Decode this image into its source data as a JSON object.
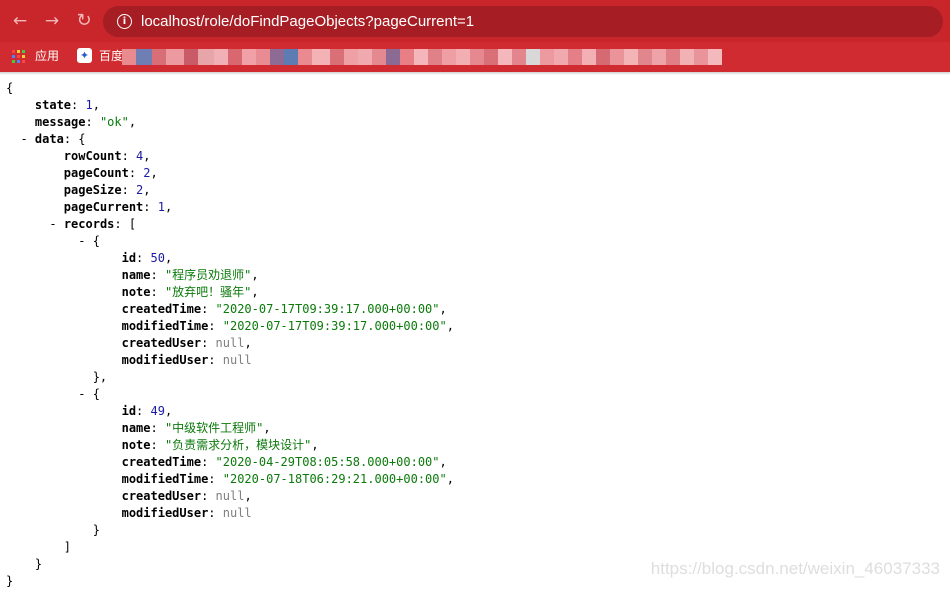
{
  "browser": {
    "url": "localhost/role/doFindPageObjects?pageCurrent=1",
    "bookmarks": [
      {
        "label": "应用",
        "icon": "apps-grid-icon"
      },
      {
        "label": "百度",
        "icon": "baidu-paw-icon"
      }
    ],
    "colors": {
      "toolbar": "#c8262b",
      "omnibox": "#a61e24",
      "bookmarks": "#cf2b31"
    }
  },
  "json": {
    "brace_open": "{",
    "brace_close": "}",
    "state_key": "state",
    "state_val": "1",
    "message_key": "message",
    "message_val": "\"ok\"",
    "data_key": "data",
    "rowCount_key": "rowCount",
    "rowCount_val": "4",
    "pageCount_key": "pageCount",
    "pageCount_val": "2",
    "pageSize_key": "pageSize",
    "pageSize_val": "2",
    "pageCurrent_key": "pageCurrent",
    "pageCurrent_val": "1",
    "records_key": "records",
    "records": [
      {
        "id": "50",
        "name": "\"程序员劝退师\"",
        "note": "\"放弃吧！骚年\"",
        "createdTime": "\"2020-07-17T09:39:17.000+00:00\"",
        "modifiedTime": "\"2020-07-17T09:39:17.000+00:00\"",
        "createdUser": "null",
        "modifiedUser": "null"
      },
      {
        "id": "49",
        "name": "\"中级软件工程师\"",
        "note": "\"负责需求分析，模块设计\"",
        "createdTime": "\"2020-04-29T08:05:58.000+00:00\"",
        "modifiedTime": "\"2020-07-18T06:29:21.000+00:00\"",
        "createdUser": "null",
        "modifiedUser": "null"
      }
    ],
    "field_names": {
      "id": "id",
      "name": "name",
      "note": "note",
      "createdTime": "createdTime",
      "modifiedTime": "modifiedTime",
      "createdUser": "createdUser",
      "modifiedUser": "modifiedUser"
    }
  },
  "watermark": "https://blog.csdn.net/weixin_46037333"
}
